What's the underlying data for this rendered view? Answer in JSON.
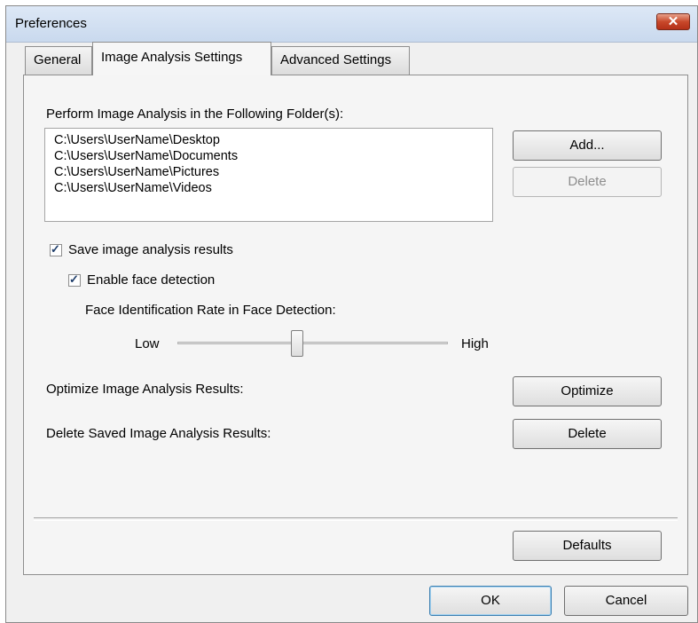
{
  "window": {
    "title": "Preferences"
  },
  "tabs": [
    {
      "label": "General",
      "active": false
    },
    {
      "label": "Image Analysis Settings",
      "active": true
    },
    {
      "label": "Advanced Settings",
      "active": false
    }
  ],
  "folders": {
    "label": "Perform Image Analysis in the Following Folder(s):",
    "items": [
      "C:\\Users\\UserName\\Desktop",
      "C:\\Users\\UserName\\Documents",
      "C:\\Users\\UserName\\Pictures",
      "C:\\Users\\UserName\\Videos"
    ],
    "add_label": "Add...",
    "delete_label": "Delete"
  },
  "options": {
    "save_results_label": "Save image analysis results",
    "save_results_checked": true,
    "face_detection_label": "Enable face detection",
    "face_detection_checked": true
  },
  "slider": {
    "label": "Face Identification Rate in Face Detection:",
    "low_label": "Low",
    "high_label": "High",
    "value": 0.44
  },
  "optimize": {
    "label": "Optimize Image Analysis Results:",
    "button": "Optimize"
  },
  "delete_saved": {
    "label": "Delete Saved Image Analysis Results:",
    "button": "Delete"
  },
  "defaults_button": "Defaults",
  "footer": {
    "ok": "OK",
    "cancel": "Cancel"
  }
}
